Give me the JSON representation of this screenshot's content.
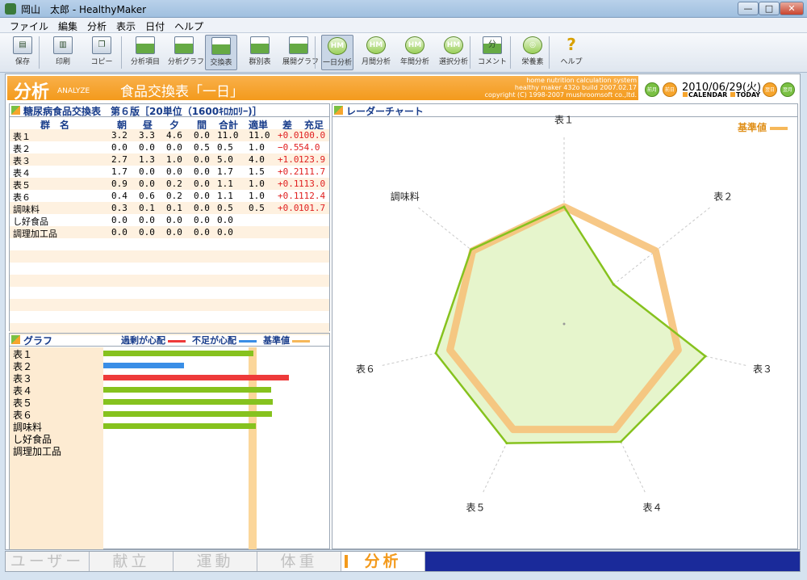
{
  "window": {
    "title": "岡山　太郎 - HealthyMaker",
    "minimize": "—",
    "maximize": "□",
    "close": "✕"
  },
  "menu": [
    "ファイル",
    "編集",
    "分析",
    "表示",
    "日付",
    "ヘルプ"
  ],
  "toolbar": [
    {
      "label": "保存",
      "icon": "save-icon"
    },
    {
      "label": "印刷",
      "icon": "print-icon"
    },
    {
      "label": "コピー",
      "icon": "copy-icon"
    },
    {
      "label": "分析項目",
      "icon": "analysis-items-icon"
    },
    {
      "label": "分析グラフ",
      "icon": "analysis-graph-icon"
    },
    {
      "label": "交換表",
      "icon": "exchange-table-icon",
      "active": true
    },
    {
      "label": "群別表",
      "icon": "group-table-icon"
    },
    {
      "label": "展開グラフ",
      "icon": "expand-graph-icon"
    },
    {
      "label": "一日分析",
      "icon": "daily-analysis-icon",
      "active": true
    },
    {
      "label": "月間分析",
      "icon": "monthly-analysis-icon"
    },
    {
      "label": "年間分析",
      "icon": "yearly-analysis-icon"
    },
    {
      "label": "選択分析",
      "icon": "selected-analysis-icon"
    },
    {
      "label": "コメント",
      "icon": "comment-icon"
    },
    {
      "label": "栄養素",
      "icon": "nutrient-icon"
    },
    {
      "label": "ヘルプ",
      "icon": "help-icon"
    }
  ],
  "header": {
    "title": "分析",
    "subtitle": "ANALYZE",
    "page_title": "食品交換表「一日」",
    "about": [
      "home nutrition calculation system",
      "healthy maker 432o build 2007.02.17",
      "copyright (C) 1998-2007 mushroomsoft co.,ltd."
    ],
    "nav": [
      "前月",
      "前日",
      "翌日",
      "翌月"
    ],
    "date": "2010/06/29(火)",
    "calendar": "CALENDAR",
    "today": "TODAY"
  },
  "exchange": {
    "heading": "糖尿病食品交換表　第６版［20単位（1600ｷﾛｶﾛﾘｰ)］",
    "columns": [
      "群　名",
      "朝",
      "昼",
      "夕",
      "間",
      "合計",
      "適単",
      "差",
      "充足"
    ],
    "rows": [
      {
        "name": "表１",
        "v": [
          "3.2",
          "3.3",
          "4.6",
          "0.0",
          "11.0",
          "11.0",
          "+0.0",
          "100.0"
        ]
      },
      {
        "name": "表２",
        "v": [
          "0.0",
          "0.0",
          "0.0",
          "0.5",
          "0.5",
          "1.0",
          "−0.5",
          "54.0"
        ]
      },
      {
        "name": "表３",
        "v": [
          "2.7",
          "1.3",
          "1.0",
          "0.0",
          "5.0",
          "4.0",
          "+1.0",
          "123.9"
        ]
      },
      {
        "name": "表４",
        "v": [
          "1.7",
          "0.0",
          "0.0",
          "0.0",
          "1.7",
          "1.5",
          "+0.2",
          "111.7"
        ]
      },
      {
        "name": "表５",
        "v": [
          "0.9",
          "0.0",
          "0.2",
          "0.0",
          "1.1",
          "1.0",
          "+0.1",
          "113.0"
        ]
      },
      {
        "name": "表６",
        "v": [
          "0.4",
          "0.6",
          "0.2",
          "0.0",
          "1.1",
          "1.0",
          "+0.1",
          "112.4"
        ]
      },
      {
        "name": "調味料",
        "v": [
          "0.3",
          "0.1",
          "0.1",
          "0.0",
          "0.5",
          "0.5",
          "+0.0",
          "101.7"
        ]
      },
      {
        "name": "し好食品",
        "v": [
          "0.0",
          "0.0",
          "0.0",
          "0.0",
          "0.0",
          "",
          "",
          ""
        ]
      },
      {
        "name": "調理加工品",
        "v": [
          "0.0",
          "0.0",
          "0.0",
          "0.0",
          "0.0",
          "",
          "",
          ""
        ]
      }
    ]
  },
  "graph": {
    "heading": "グラフ",
    "legend": [
      {
        "label": "過剰が心配",
        "color": "#ee3a3a"
      },
      {
        "label": "不足が心配",
        "color": "#3a8ee6"
      },
      {
        "label": "基準値",
        "color": "#f6b85a"
      }
    ],
    "labels": [
      "表１",
      "表２",
      "表３",
      "表４",
      "表５",
      "表６",
      "調味料",
      "し好食品",
      "調理加工品"
    ],
    "bars": [
      {
        "value": 100.0,
        "status": "ok"
      },
      {
        "value": 54.0,
        "status": "under"
      },
      {
        "value": 123.9,
        "status": "over"
      },
      {
        "value": 111.7,
        "status": "ok"
      },
      {
        "value": 113.0,
        "status": "ok"
      },
      {
        "value": 112.4,
        "status": "ok"
      },
      {
        "value": 101.7,
        "status": "ok"
      },
      {
        "value": 0,
        "status": "none"
      },
      {
        "value": 0,
        "status": "none"
      }
    ],
    "colors": {
      "ok": "#86c21e",
      "under": "#3a8ee6",
      "over": "#ee3a3a"
    }
  },
  "radar": {
    "heading": "レーダーチャート",
    "legend": "基準値",
    "axes": [
      "表１",
      "表２",
      "表３",
      "表４",
      "表５",
      "表６",
      "調味料"
    ],
    "values": [
      100.0,
      54.0,
      123.9,
      111.7,
      113.0,
      112.4,
      101.7
    ],
    "baseline": 100,
    "colors": {
      "series": "#86c21e",
      "fill": "#e6f5cc",
      "baseline": "#f6c27a"
    }
  },
  "tabs": [
    "ユーザー",
    "献立",
    "運動",
    "体重",
    "分析"
  ],
  "active_tab": "分析"
}
